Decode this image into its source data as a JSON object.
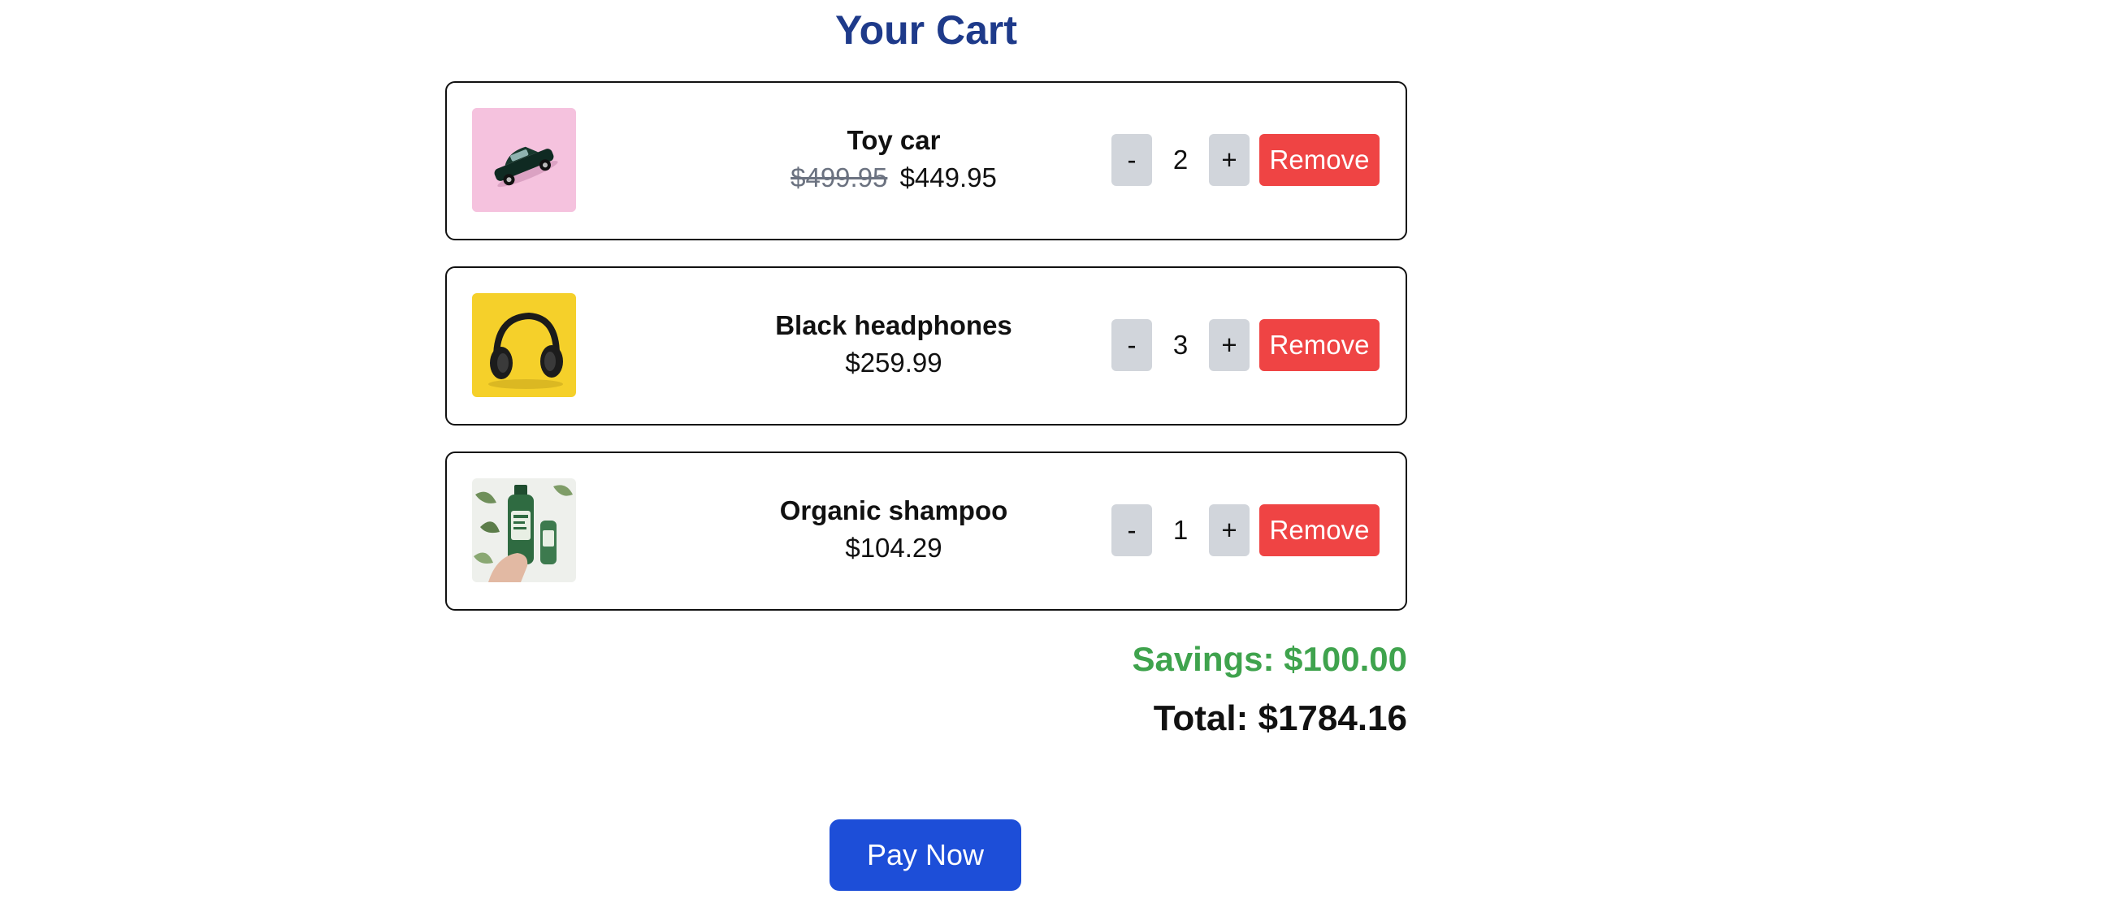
{
  "page": {
    "title": "Your Cart"
  },
  "cart": {
    "items": [
      {
        "name": "Toy car",
        "original_price": "$499.95",
        "price": "$449.95",
        "quantity": "2",
        "image_icon": "toy-car-image",
        "image_bg": "#f3b8d9"
      },
      {
        "name": "Black headphones",
        "original_price": "",
        "price": "$259.99",
        "quantity": "3",
        "image_icon": "headphones-image",
        "image_bg": "#f5d02a"
      },
      {
        "name": "Organic shampoo",
        "original_price": "",
        "price": "$104.29",
        "quantity": "1",
        "image_icon": "shampoo-bottle-image",
        "image_bg": "#eef0ec"
      }
    ],
    "controls": {
      "decrement_label": "-",
      "increment_label": "+",
      "remove_label": "Remove"
    }
  },
  "summary": {
    "savings": "Savings: $100.00",
    "total": "Total: $1784.16"
  },
  "checkout": {
    "pay_label": "Pay Now"
  },
  "colors": {
    "title": "#1e3a8a",
    "remove": "#ef4444",
    "quantity_button": "#d1d5db",
    "savings": "#3fa34d",
    "pay": "#1d4ed8",
    "card_border": "#111111"
  }
}
